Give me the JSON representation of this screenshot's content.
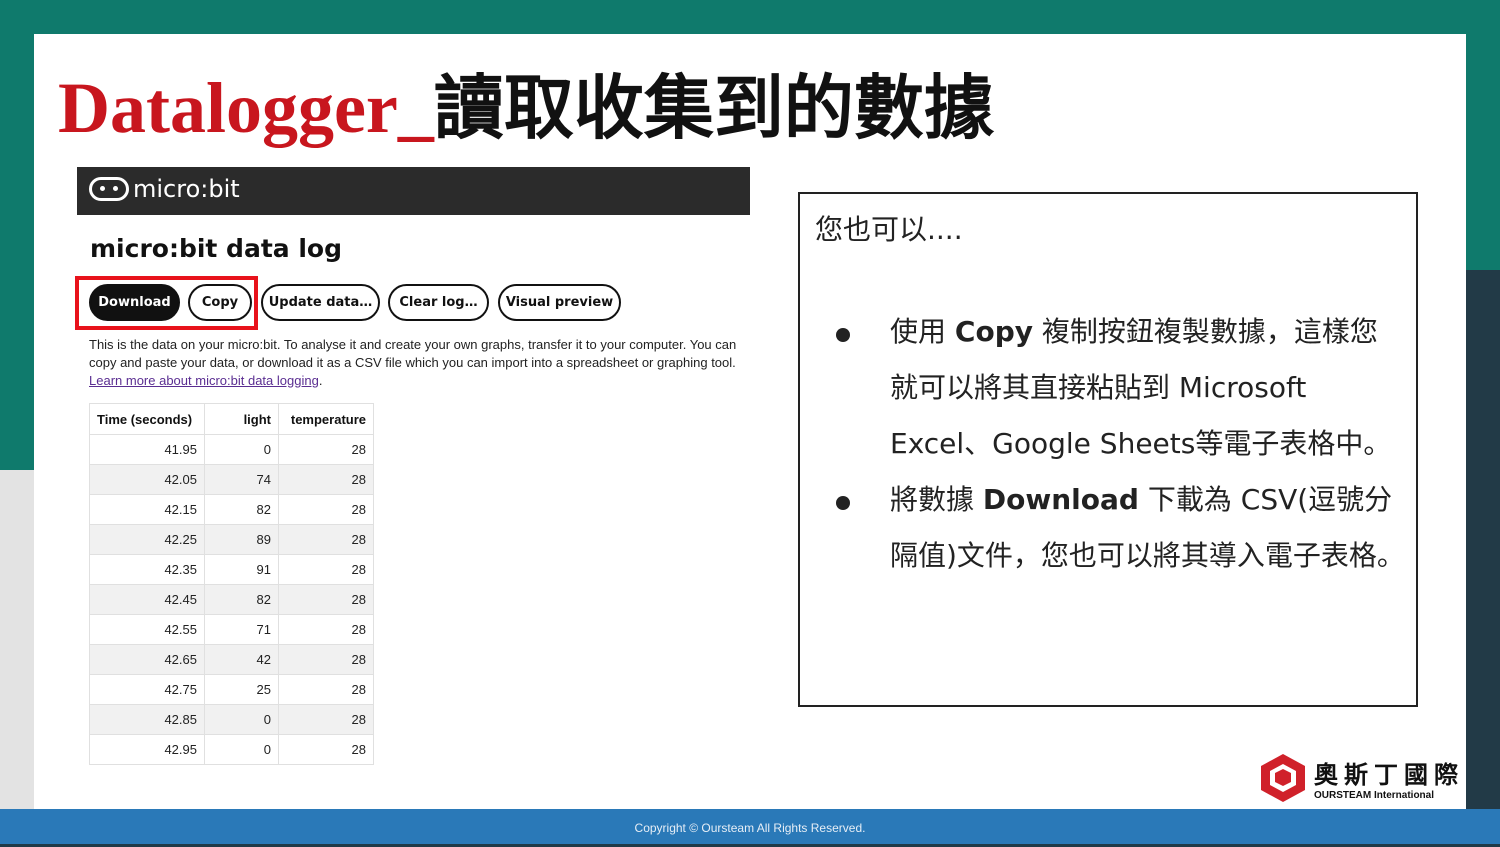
{
  "title": {
    "en": "Datalogger_",
    "zh": "讀取收集到的數據"
  },
  "microbit": {
    "brand": "micro:bit",
    "page_title": "micro:bit data log",
    "buttons": {
      "download": "Download",
      "copy": "Copy",
      "update": "Update data…",
      "clear": "Clear log…",
      "visual": "Visual preview"
    },
    "description": "This is the data on your micro:bit. To analyse it and create your own graphs, transfer it to your computer. You can copy and paste your data, or download it as a CSV file which you can import into a spreadsheet or graphing tool. ",
    "learn_more": "Learn more about micro:bit data logging",
    "table": {
      "headers": [
        "Time (seconds)",
        "light",
        "temperature"
      ],
      "rows": [
        [
          "41.95",
          "0",
          "28"
        ],
        [
          "42.05",
          "74",
          "28"
        ],
        [
          "42.15",
          "82",
          "28"
        ],
        [
          "42.25",
          "89",
          "28"
        ],
        [
          "42.35",
          "91",
          "28"
        ],
        [
          "42.45",
          "82",
          "28"
        ],
        [
          "42.55",
          "71",
          "28"
        ],
        [
          "42.65",
          "42",
          "28"
        ],
        [
          "42.75",
          "25",
          "28"
        ],
        [
          "42.85",
          "0",
          "28"
        ],
        [
          "42.95",
          "0",
          "28"
        ]
      ]
    }
  },
  "notes": {
    "lead": "您也可以....",
    "bullet1": {
      "pre": "使用 ",
      "bold": "Copy",
      "post": " 複制按鈕複製數據，這樣您就可以將其直接粘貼到 Microsoft Excel、Google Sheets等電子表格中。"
    },
    "bullet2": {
      "pre": "將數據 ",
      "bold": "Download",
      "post": " 下載為 CSV(逗號分隔值)文件，您也可以將其導入電子表格。"
    }
  },
  "brand": {
    "zh": "奧斯丁國際",
    "en": "OURSTEAM International"
  },
  "footer": "Copyright © Oursteam All Rights Reserved.",
  "colors": {
    "title_red": "#c8161e",
    "teal": "#0f7a6c",
    "footer_blue": "#2a79b8",
    "highlight": "#e8121b"
  }
}
